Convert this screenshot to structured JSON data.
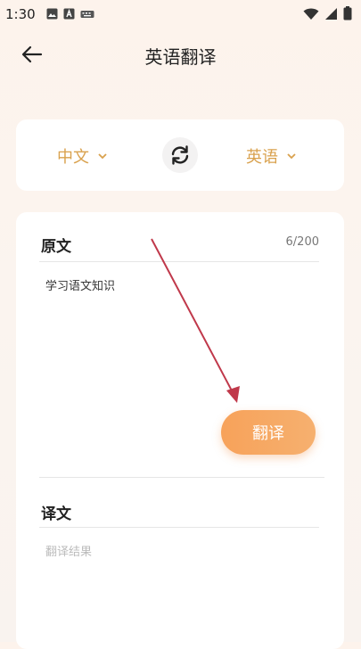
{
  "status_bar": {
    "time": "1:30"
  },
  "header": {
    "title": "英语翻译"
  },
  "language_bar": {
    "source_lang": "中文",
    "target_lang": "英语"
  },
  "source": {
    "label": "原文",
    "char_count": "6/200",
    "text": "学习语文知识"
  },
  "translate_button": {
    "label": "翻译"
  },
  "result": {
    "label": "译文",
    "placeholder": "翻译结果"
  },
  "colors": {
    "accent": "#d9a14d",
    "button": "#f7a25a",
    "annotation_arrow": "#c0394b"
  }
}
